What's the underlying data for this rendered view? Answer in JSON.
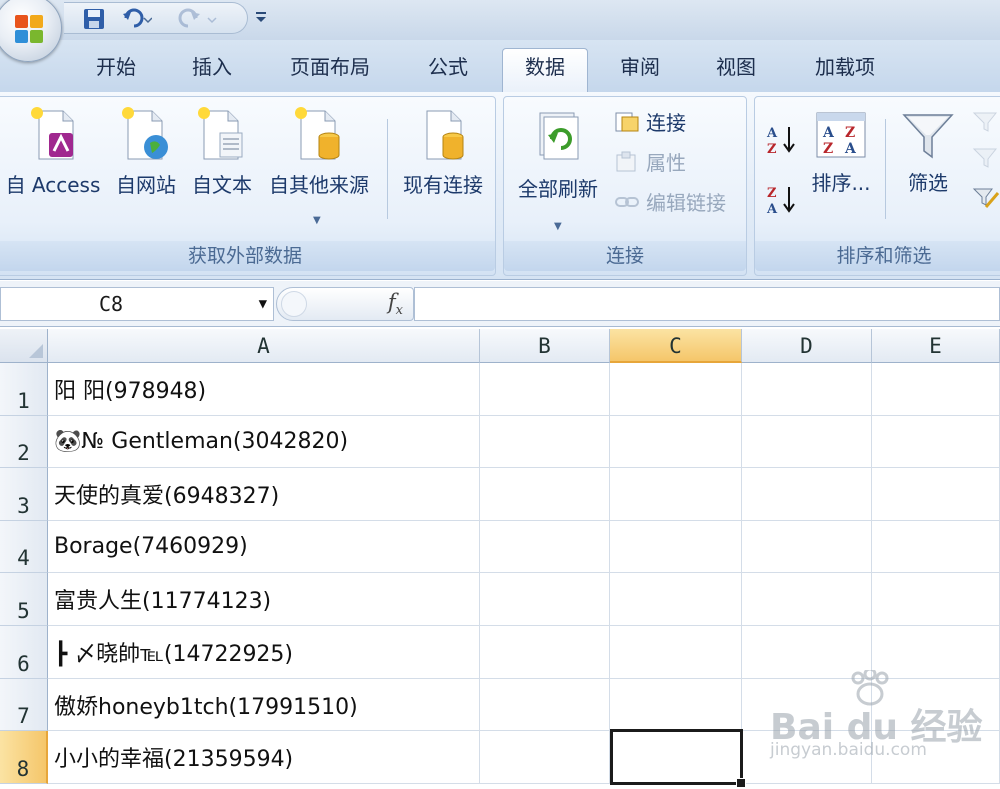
{
  "ribbon_tabs": [
    "开始",
    "插入",
    "页面布局",
    "公式",
    "数据",
    "审阅",
    "视图",
    "加载项"
  ],
  "active_tab": "数据",
  "get_external_data": {
    "access": "自 Access",
    "web": "自网站",
    "text": "自文本",
    "other": "自其他来源",
    "existing": "现有连接",
    "group_label": "获取外部数据"
  },
  "connections": {
    "refresh_all": "全部刷新",
    "connections": "连接",
    "properties": "属性",
    "edit_links": "编辑链接",
    "group_label": "连接"
  },
  "sort_filter": {
    "sort": "排序...",
    "filter": "筛选",
    "group_label": "排序和筛选"
  },
  "formula_bar": {
    "name_box": "C8",
    "fx": "fx"
  },
  "columns": [
    "A",
    "B",
    "C",
    "D",
    "E"
  ],
  "selected_column": "C",
  "rows": [
    {
      "num": "1",
      "a": "阳 阳(978948)"
    },
    {
      "num": "2",
      "a": "🐼№ Gentleman(3042820)"
    },
    {
      "num": "3",
      "a": "天使的真爱(6948327)"
    },
    {
      "num": "4",
      "a": "Borage(7460929)"
    },
    {
      "num": "5",
      "a": "富贵人生(11774123)"
    },
    {
      "num": "6",
      "a": "┣ 〆晓帥℡(14722925)"
    },
    {
      "num": "7",
      "a": "傲娇honeyb1tch(17991510)"
    },
    {
      "num": "8",
      "a": "小小的幸福(21359594)"
    }
  ],
  "watermark": {
    "brand": "Bai du 经验",
    "url": "jingyan.baidu.com"
  }
}
